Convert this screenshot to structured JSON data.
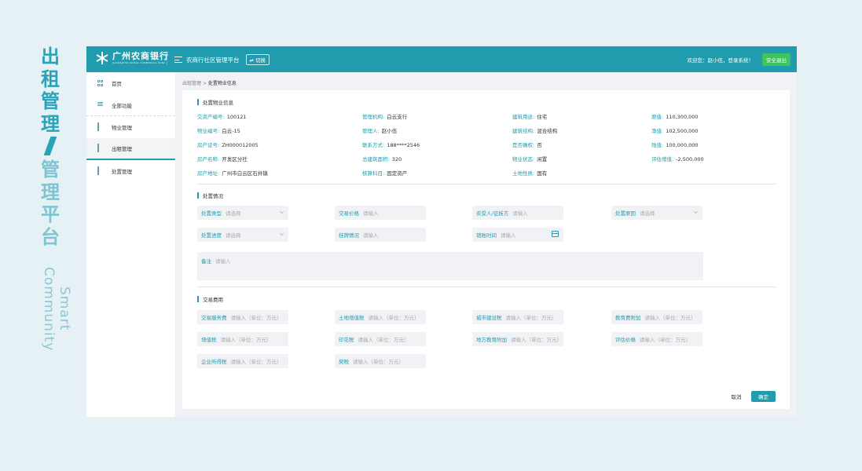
{
  "branding": {
    "line1": [
      "出",
      "租",
      "管",
      "理"
    ],
    "line2": [
      "管",
      "理",
      "平",
      "台"
    ],
    "en": "Smart Community"
  },
  "header": {
    "logo_cn": "广州农商银行",
    "logo_en": "GUANGZHOU RURAL COMMERCIAL BANK",
    "platform": "农商行社区管理平台",
    "switch": "⇌ 切换",
    "welcome": "欢迎您：赵小伍，登录系统！",
    "logout": "安全退出",
    "accent": "#209cae",
    "logout_color": "#3fc35f"
  },
  "sidebar": {
    "items": [
      {
        "label": "首页",
        "icon": "grid-icon"
      },
      {
        "label": "全部功能",
        "icon": "list-icon"
      },
      {
        "label": "物业管理",
        "icon": "cube-icon"
      },
      {
        "label": "出租管理",
        "icon": "cube-icon"
      },
      {
        "label": "处置管理",
        "icon": "cube-icon"
      }
    ]
  },
  "breadcrumb": {
    "parent": "出租管理",
    "sep": " > ",
    "current": "处置物业信息"
  },
  "property": {
    "title": "处置物业信息",
    "rows": [
      [
        {
          "k": "交资产编号:",
          "v": "100121"
        },
        {
          "k": "管理机构:",
          "v": "白云支行"
        },
        {
          "k": "建筑用途:",
          "v": "住宅"
        },
        {
          "k": "原值:",
          "v": "110,300,000"
        }
      ],
      [
        {
          "k": "物业编号:",
          "v": "白云-15"
        },
        {
          "k": "管理人:",
          "v": "赵小伍"
        },
        {
          "k": "建筑结构:",
          "v": "混合结构"
        },
        {
          "k": "净值:",
          "v": "102,500,000"
        }
      ],
      [
        {
          "k": "房产证号:",
          "v": "ZH000012005"
        },
        {
          "k": "联系方式:",
          "v": "188****2546"
        },
        {
          "k": "是否确权:",
          "v": "否"
        },
        {
          "k": "残值:",
          "v": "100,000,000"
        }
      ],
      [
        {
          "k": "房产名称:",
          "v": "开发区分社"
        },
        {
          "k": "总建筑面积:",
          "v": "320"
        },
        {
          "k": "物业状态:",
          "v": "闲置"
        },
        {
          "k": "评估增值:",
          "v": "-2,500,000"
        }
      ],
      [
        {
          "k": "房产地址:",
          "v": "广州市白云区石井镇"
        },
        {
          "k": "核算科目:",
          "v": "固定资产"
        },
        {
          "k": "土地性质:",
          "v": "国有"
        }
      ]
    ]
  },
  "disposal": {
    "title": "处置情况",
    "fields": [
      {
        "label": "处置类型",
        "ph": "请选择",
        "kind": "select"
      },
      {
        "label": "交易价格",
        "ph": "请输入",
        "kind": "input"
      },
      {
        "label": "买受人/征拆方",
        "ph": "请输入",
        "kind": "input"
      },
      {
        "label": "处置原因",
        "ph": "请选择",
        "kind": "select"
      },
      {
        "label": "处置进度",
        "ph": "请选择",
        "kind": "select"
      },
      {
        "label": "挂牌情况",
        "ph": "请输入",
        "kind": "input"
      },
      {
        "label": "销账时间",
        "ph": "请输入",
        "kind": "date"
      }
    ],
    "remark": {
      "label": "备注",
      "ph": "请输入"
    }
  },
  "fees": {
    "title": "交易费用",
    "fields": [
      {
        "label": "交易服务费",
        "ph": "请输入（单位：万元）"
      },
      {
        "label": "土地增值税",
        "ph": "请输入（单位：万元）"
      },
      {
        "label": "城市建设税",
        "ph": "请输入（单位：万元）"
      },
      {
        "label": "教育费附加",
        "ph": "请输入（单位：万元）"
      },
      {
        "label": "增值税",
        "ph": "请输入（单位：万元）"
      },
      {
        "label": "印花税",
        "ph": "请输入（单位：万元）"
      },
      {
        "label": "地方教育附加",
        "ph": "请输入（单位：万元）"
      },
      {
        "label": "评估价格",
        "ph": "请输入（单位：万元）"
      },
      {
        "label": "企业所得税",
        "ph": "请输入（单位：万元）"
      },
      {
        "label": "契税",
        "ph": "请输入（单位：万元）"
      }
    ]
  },
  "actions": {
    "cancel": "取消",
    "ok": "确定"
  }
}
